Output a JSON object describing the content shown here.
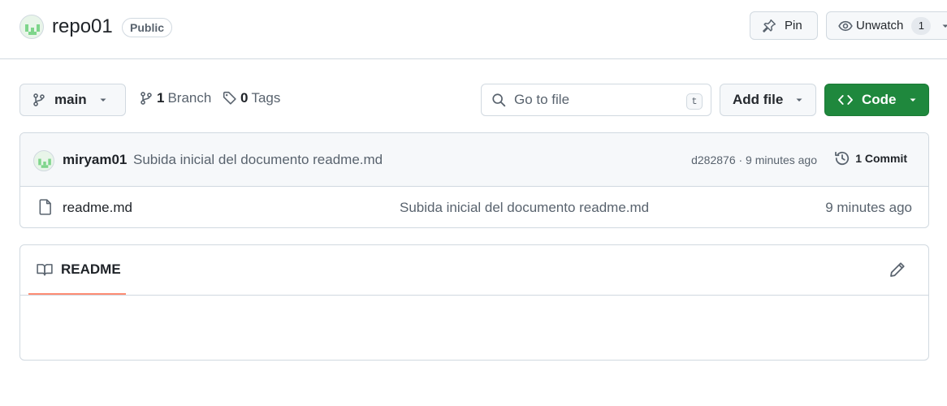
{
  "repo": {
    "name": "repo01",
    "visibility": "Public",
    "pin_label": "Pin",
    "watch_label": "Unwatch",
    "watch_count": "1"
  },
  "toolbar": {
    "branch": "main",
    "branch_count": "1",
    "branch_label": "Branch",
    "tag_count": "0",
    "tag_label": "Tags",
    "search_placeholder": "Go to file",
    "search_shortcut": "t",
    "add_file_label": "Add file",
    "code_label": "Code"
  },
  "commit": {
    "author": "miryam01",
    "message": "Subida inicial del documento readme.md",
    "hash_time": "d282876 · 9 minutes ago",
    "commits_label": "1 Commit"
  },
  "files": [
    {
      "name": "readme.md",
      "commit_message": "Subida inicial del documento readme.md",
      "date": "9 minutes ago"
    }
  ],
  "readme": {
    "tab_label": "README"
  },
  "colors": {
    "code_button": "#1f883d",
    "readme_tab_underline": "#fd8c73",
    "border": "#d1d9e0",
    "muted_text": "#59636e"
  }
}
